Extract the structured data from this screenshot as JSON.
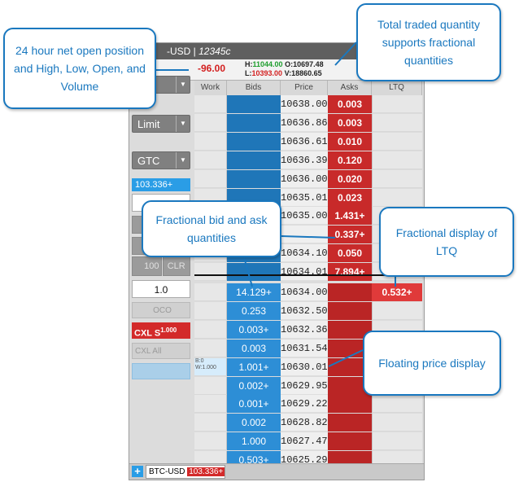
{
  "window": {
    "title_prefix": "-USD | ",
    "title_account": "12345c"
  },
  "info": {
    "net_position": "-96.00",
    "h_label": "H:",
    "high": "11044.00",
    "o_label": "O:",
    "open": "10697.48",
    "l_label": "L:",
    "low": "10393.00",
    "v_label": "V:",
    "volume": "18860.65"
  },
  "controls": {
    "account_dropdown": "5c",
    "order_type": "Limit",
    "tif": "GTC",
    "position_chip": "103.336+",
    "qty_button": "100",
    "clr_button": "CLR",
    "quantity": "1.0",
    "oco_button": "OCO",
    "cxl_s_button": "CXL S",
    "cxl_s_qty": "1.000",
    "cxl_all_button": "CXL All"
  },
  "ladder": {
    "headers": {
      "work": "Work",
      "bids": "Bids",
      "price": "Price",
      "asks": "Asks",
      "ltq": "LTQ"
    },
    "rows": [
      {
        "price": "10638.00",
        "bid": "",
        "ask": "0.003",
        "ltq": "",
        "work": ""
      },
      {
        "price": "10636.86",
        "bid": "",
        "ask": "0.003",
        "ltq": "",
        "work": ""
      },
      {
        "price": "10636.61",
        "bid": "",
        "ask": "0.010",
        "ltq": "",
        "work": ""
      },
      {
        "price": "10636.39",
        "bid": "",
        "ask": "0.120",
        "ltq": "",
        "work": ""
      },
      {
        "price": "10636.00",
        "bid": "",
        "ask": "0.020",
        "ltq": "",
        "work": ""
      },
      {
        "price": "10635.01",
        "bid": "",
        "ask": "0.023",
        "ltq": "",
        "work": ""
      },
      {
        "price": "10635.00",
        "bid": "",
        "ask": "1.431+",
        "ltq": "",
        "work": ""
      },
      {
        "price": "",
        "bid": "",
        "ask": "0.337+",
        "ltq": "",
        "work": ""
      },
      {
        "price": "10634.10",
        "bid": "",
        "ask": "0.050",
        "ltq": "",
        "work": ""
      },
      {
        "price": "10634.01",
        "bid": "",
        "ask": "7.894+",
        "ltq": "",
        "work": ""
      },
      {
        "price": "10634.00",
        "bid": "14.129+",
        "ask": "",
        "ltq": "0.532+",
        "work": ""
      },
      {
        "price": "10632.50",
        "bid": "0.253",
        "ask": "",
        "ltq": "",
        "work": ""
      },
      {
        "price": "10632.36",
        "bid": "0.003+",
        "ask": "",
        "ltq": "",
        "work": ""
      },
      {
        "price": "10631.54",
        "bid": "0.003",
        "ask": "",
        "ltq": "",
        "work": ""
      },
      {
        "price": "10630.01",
        "bid": "1.001+",
        "ask": "",
        "ltq": "",
        "work": "B:0\nW:1.000"
      },
      {
        "price": "10629.95",
        "bid": "0.002+",
        "ask": "",
        "ltq": "",
        "work": ""
      },
      {
        "price": "10629.22",
        "bid": "0.001+",
        "ask": "",
        "ltq": "",
        "work": ""
      },
      {
        "price": "10628.82",
        "bid": "0.002",
        "ask": "",
        "ltq": "",
        "work": ""
      },
      {
        "price": "10627.47",
        "bid": "1.000",
        "ask": "",
        "ltq": "",
        "work": ""
      },
      {
        "price": "10625.29",
        "bid": "0.503+",
        "ask": "",
        "ltq": "",
        "work": ""
      }
    ]
  },
  "bottom": {
    "plus": "+",
    "tab_symbol": "BTC-USD",
    "tab_value": "103.336+"
  },
  "callouts": {
    "net_open": "24 hour net open position and High, Low, Open, and Volume",
    "traded_qty": "Total traded quantity supports fractional quantities",
    "bid_ask": "Fractional bid and ask quantities",
    "ltq": "Fractional display of LTQ",
    "floating": "Floating price display"
  },
  "colors": {
    "accent": "#1a78bf",
    "bid": "#2d8ed6",
    "ask": "#c82a2a"
  }
}
